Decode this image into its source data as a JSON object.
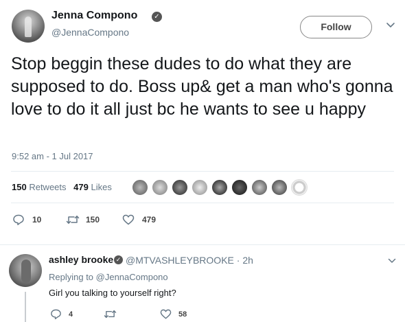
{
  "tweet": {
    "author_name": "Jenna Compono",
    "author_handle": "@JennaCompono",
    "verified": true,
    "follow_label": "Follow",
    "text": "Stop beggin these dudes to do what they are supposed to do. Boss up& get a man who's gonna love to do it all just bc he wants to see u happy",
    "timestamp": "9:52 am - 1 Jul 2017",
    "retweets_count": "150",
    "retweets_label": "Retweets",
    "likes_count": "479",
    "likes_label": "Likes",
    "likers": [
      "avatar-1",
      "avatar-2",
      "avatar-3",
      "avatar-4",
      "avatar-5",
      "avatar-6",
      "avatar-7",
      "avatar-8",
      "avatar-9"
    ],
    "actions": {
      "reply_count": "10",
      "retweet_count": "150",
      "like_count": "479"
    }
  },
  "reply": {
    "author_name": "ashley brooke",
    "author_handle": "@MTVASHLEYBROOKE",
    "time": "2h",
    "verified": true,
    "replying_to": "Replying to @JennaCompono",
    "text": "Girl you talking to yourself right?",
    "actions": {
      "reply_count": "4",
      "retweet_count": "",
      "like_count": "58"
    }
  }
}
